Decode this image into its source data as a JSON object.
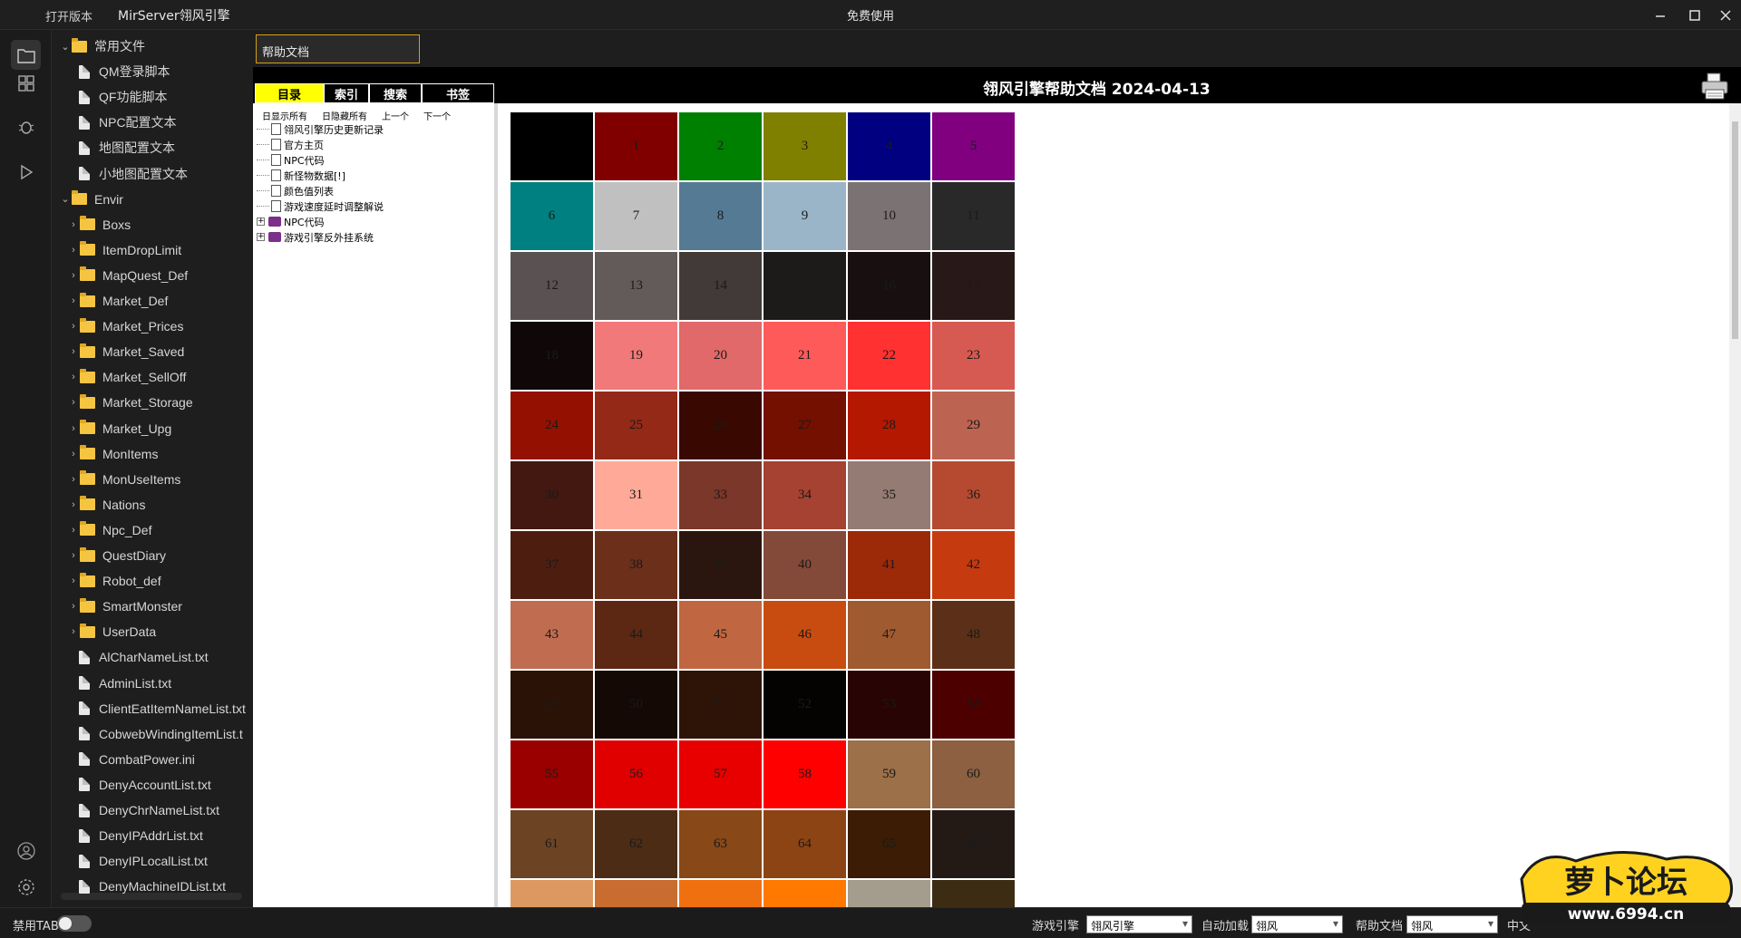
{
  "titlebar": {
    "open_version": "打开版本",
    "app_title": "MirServer翎风引擎",
    "center_text": "免费使用",
    "minimize": "—",
    "maximize": "☐",
    "close": "✕"
  },
  "activity": {
    "icons": [
      "folder-icon",
      "extensions-icon",
      "debug-icon",
      "run-icon",
      "account-icon",
      "settings-icon"
    ]
  },
  "explorer": {
    "items": [
      {
        "label": "常用文件",
        "kind": "folder",
        "depth": 0,
        "expanded": true
      },
      {
        "label": "QM登录脚本",
        "kind": "file",
        "depth": 1
      },
      {
        "label": "QF功能脚本",
        "kind": "file",
        "depth": 1
      },
      {
        "label": "NPC配置文本",
        "kind": "file",
        "depth": 1
      },
      {
        "label": "地图配置文本",
        "kind": "file",
        "depth": 1
      },
      {
        "label": "小地图配置文本",
        "kind": "file",
        "depth": 1
      },
      {
        "label": "Envir",
        "kind": "folder",
        "depth": 0,
        "expanded": true
      },
      {
        "label": "Boxs",
        "kind": "folder",
        "depth": 1
      },
      {
        "label": "ItemDropLimit",
        "kind": "folder",
        "depth": 1
      },
      {
        "label": "MapQuest_Def",
        "kind": "folder",
        "depth": 1
      },
      {
        "label": "Market_Def",
        "kind": "folder",
        "depth": 1
      },
      {
        "label": "Market_Prices",
        "kind": "folder",
        "depth": 1
      },
      {
        "label": "Market_Saved",
        "kind": "folder",
        "depth": 1
      },
      {
        "label": "Market_SellOff",
        "kind": "folder",
        "depth": 1
      },
      {
        "label": "Market_Storage",
        "kind": "folder",
        "depth": 1
      },
      {
        "label": "Market_Upg",
        "kind": "folder",
        "depth": 1
      },
      {
        "label": "MonItems",
        "kind": "folder",
        "depth": 1
      },
      {
        "label": "MonUseItems",
        "kind": "folder",
        "depth": 1
      },
      {
        "label": "Nations",
        "kind": "folder",
        "depth": 1
      },
      {
        "label": "Npc_Def",
        "kind": "folder",
        "depth": 1
      },
      {
        "label": "QuestDiary",
        "kind": "folder",
        "depth": 1
      },
      {
        "label": "Robot_def",
        "kind": "folder",
        "depth": 1
      },
      {
        "label": "SmartMonster",
        "kind": "folder",
        "depth": 1
      },
      {
        "label": "UserData",
        "kind": "folder",
        "depth": 1
      },
      {
        "label": "AlCharNameList.txt",
        "kind": "file",
        "depth": 1
      },
      {
        "label": "AdminList.txt",
        "kind": "file",
        "depth": 1
      },
      {
        "label": "ClientEatItemNameList.txt",
        "kind": "file",
        "depth": 1
      },
      {
        "label": "CobwebWindingItemList.t",
        "kind": "file",
        "depth": 1
      },
      {
        "label": "CombatPower.ini",
        "kind": "file",
        "depth": 1
      },
      {
        "label": "DenyAccountList.txt",
        "kind": "file",
        "depth": 1
      },
      {
        "label": "DenyChrNameList.txt",
        "kind": "file",
        "depth": 1
      },
      {
        "label": "DenyIPAddrList.txt",
        "kind": "file",
        "depth": 1
      },
      {
        "label": "DenyIPLocalList.txt",
        "kind": "file",
        "depth": 1
      },
      {
        "label": "DenyMachineIDList.txt",
        "kind": "file",
        "depth": 1
      }
    ]
  },
  "help": {
    "input_value": "帮助文档",
    "heading": "翎风引擎帮助文档 2024-04-13",
    "tabs": [
      "目录",
      "索引",
      "搜索",
      "书签"
    ],
    "active_tab": 0,
    "tools": [
      "日显示所有",
      "日隐藏所有",
      "上一个",
      "下一个"
    ],
    "toc": [
      {
        "label": "翎风引擎历史更新记录",
        "icon": "doc"
      },
      {
        "label": "官方主页",
        "icon": "doc"
      },
      {
        "label": "NPC代码",
        "icon": "doc"
      },
      {
        "label": "新怪物数据[!]",
        "icon": "doc"
      },
      {
        "label": "颜色值列表",
        "icon": "doc"
      },
      {
        "label": "游戏速度延时调整解说",
        "icon": "doc"
      },
      {
        "label": "NPC代码",
        "icon": "book"
      },
      {
        "label": "游戏引擎反外挂系统",
        "icon": "book"
      }
    ],
    "color_cells": [
      {
        "n": "",
        "c": "#000000"
      },
      {
        "n": "1",
        "c": "#800000"
      },
      {
        "n": "2",
        "c": "#008000"
      },
      {
        "n": "3",
        "c": "#808000"
      },
      {
        "n": "4",
        "c": "#000080"
      },
      {
        "n": "5",
        "c": "#800080"
      },
      {
        "n": "6",
        "c": "#008080"
      },
      {
        "n": "7",
        "c": "#c0c0c0"
      },
      {
        "n": "8",
        "c": "#557a94"
      },
      {
        "n": "9",
        "c": "#9ab5c8"
      },
      {
        "n": "10",
        "c": "#7b7373"
      },
      {
        "n": "11",
        "c": "#292929"
      },
      {
        "n": "12",
        "c": "#5a5252"
      },
      {
        "n": "13",
        "c": "#635a5a"
      },
      {
        "n": "14",
        "c": "#423939"
      },
      {
        "n": "15",
        "c": "#1d1a1a"
      },
      {
        "n": "16",
        "c": "#181010"
      },
      {
        "n": "17",
        "c": "#291818"
      },
      {
        "n": "18",
        "c": "#100808"
      },
      {
        "n": "19",
        "c": "#f27979"
      },
      {
        "n": "20",
        "c": "#e16969"
      },
      {
        "n": "21",
        "c": "#ff5a5a"
      },
      {
        "n": "22",
        "c": "#ff3131"
      },
      {
        "n": "23",
        "c": "#d65a52"
      },
      {
        "n": "24",
        "c": "#941000"
      },
      {
        "n": "25",
        "c": "#942918"
      },
      {
        "n": "26",
        "c": "#390800"
      },
      {
        "n": "27",
        "c": "#731000"
      },
      {
        "n": "28",
        "c": "#b51800"
      },
      {
        "n": "29",
        "c": "#bd6352"
      },
      {
        "n": "30",
        "c": "#421810"
      },
      {
        "n": "31",
        "c": "#ffaa99"
      },
      {
        "n": "33",
        "c": "#7b3729"
      },
      {
        "n": "34",
        "c": "#a54231"
      },
      {
        "n": "35",
        "c": "#947b73"
      },
      {
        "n": "36",
        "c": "#b54a31"
      },
      {
        "n": "37",
        "c": "#4d1e0f"
      },
      {
        "n": "38",
        "c": "#6b2f1a"
      },
      {
        "n": "39",
        "c": "#2a160e"
      },
      {
        "n": "40",
        "c": "#844a39"
      },
      {
        "n": "41",
        "c": "#9c2a08"
      },
      {
        "n": "42",
        "c": "#c63a10"
      },
      {
        "n": "43",
        "c": "#c06c50"
      },
      {
        "n": "44",
        "c": "#5c2814"
      },
      {
        "n": "45",
        "c": "#c06640"
      },
      {
        "n": "46",
        "c": "#c84c10"
      },
      {
        "n": "47",
        "c": "#a05a30"
      },
      {
        "n": "48",
        "c": "#5c3018"
      },
      {
        "n": "49",
        "c": "#2b1206"
      },
      {
        "n": "50",
        "c": "#140904"
      },
      {
        "n": "51",
        "c": "#2e1406"
      },
      {
        "n": "52",
        "c": "#050202"
      },
      {
        "n": "53",
        "c": "#290404"
      },
      {
        "n": "54",
        "c": "#4c0000"
      },
      {
        "n": "55",
        "c": "#9a0000"
      },
      {
        "n": "56",
        "c": "#e00000"
      },
      {
        "n": "57",
        "c": "#e80000"
      },
      {
        "n": "58",
        "c": "#ff0000"
      },
      {
        "n": "59",
        "c": "#9c7048"
      },
      {
        "n": "60",
        "c": "#8c6040"
      },
      {
        "n": "61",
        "c": "#6c4424"
      },
      {
        "n": "62",
        "c": "#4c2c14"
      },
      {
        "n": "63",
        "c": "#884818"
      },
      {
        "n": "64",
        "c": "#8c4414"
      },
      {
        "n": "65",
        "c": "#3c1c04"
      },
      {
        "n": "66",
        "c": "#231a16"
      },
      {
        "n": "",
        "c": "#dc9860"
      },
      {
        "n": "",
        "c": "#c86c30"
      },
      {
        "n": "",
        "c": "#f07010"
      },
      {
        "n": "",
        "c": "#ff7800"
      },
      {
        "n": "",
        "c": "#a49c8c"
      },
      {
        "n": "",
        "c": "#3c2c14"
      }
    ]
  },
  "statusbar": {
    "disable_tab": "禁用TAB",
    "game_engine_label": "游戏引擎",
    "game_engine_value": "翎风引擎",
    "auto_load_label": "自动加载",
    "auto_load_value": "翎风",
    "help_doc_label": "帮助文档",
    "help_doc_value": "翎风",
    "lang": "中文"
  },
  "watermark": {
    "text": "萝卜论坛",
    "url": "www.6994.cn"
  },
  "colors": {
    "accent_yellow": "#ffff00",
    "input_border": "#d4a017"
  }
}
